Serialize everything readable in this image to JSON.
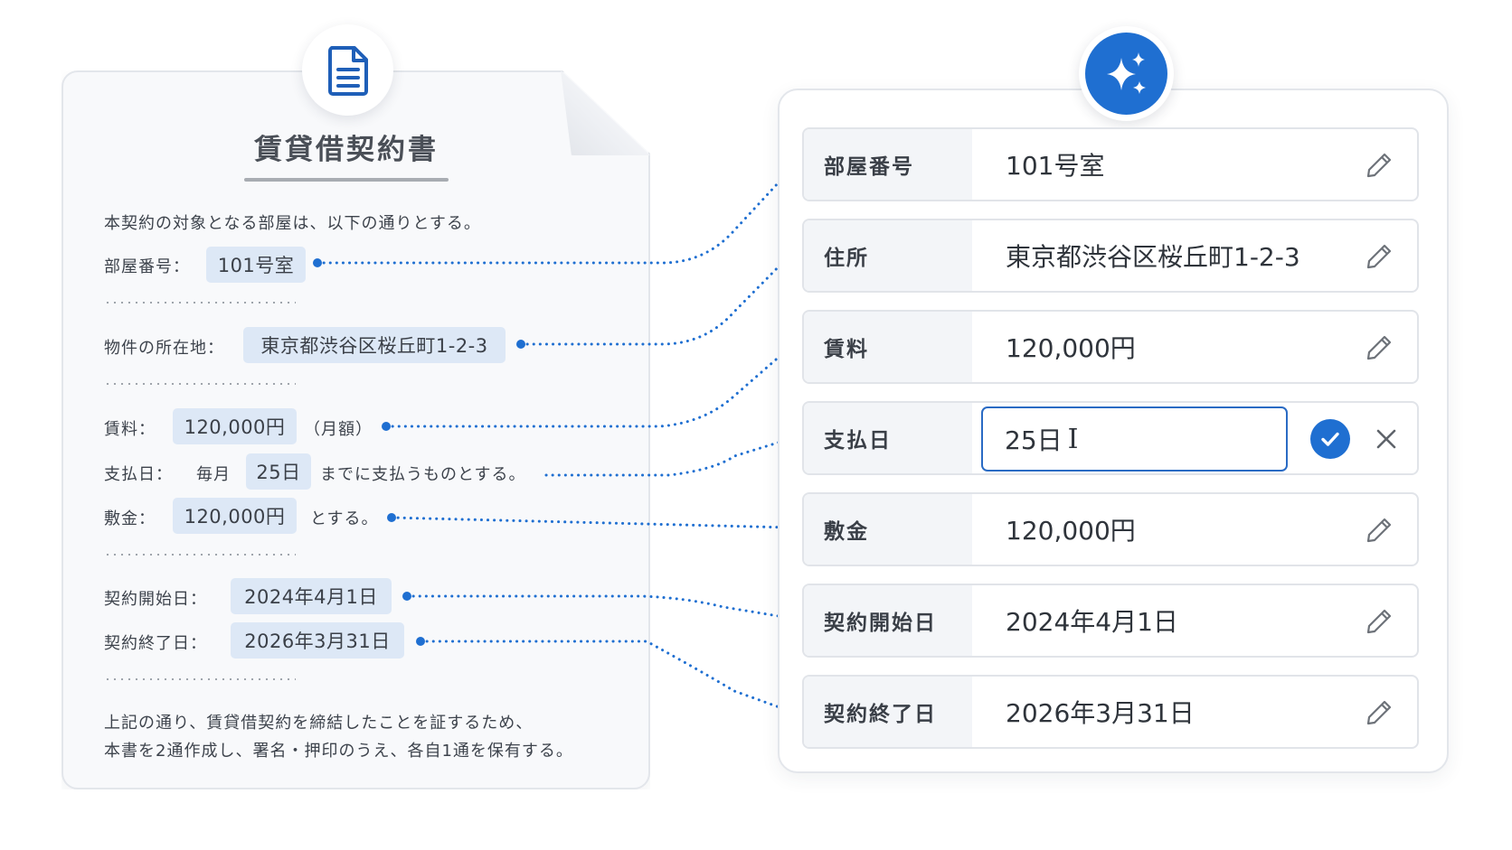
{
  "document": {
    "title": "賃貸借契約書",
    "intro": "本契約の対象となる部屋は、以下の通りとする。",
    "room_label": "部屋番号：",
    "room_value": "101号室",
    "address_label": "物件の所在地：",
    "address_value": "東京都渋谷区桜丘町1-2-3",
    "rent_label": "賃料：",
    "rent_value": "120,000円",
    "rent_suffix": "（月額）",
    "payday_label": "支払日：",
    "payday_prefix": "毎月",
    "payday_value": "25日",
    "payday_suffix": "までに支払うものとする。",
    "deposit_label": "敷金：",
    "deposit_value": "120,000円",
    "deposit_suffix": "とする。",
    "start_label": "契約開始日：",
    "start_value": "2024年4月1日",
    "end_label": "契約終了日：",
    "end_value": "2026年3月31日",
    "closing_1": "上記の通り、賃貸借契約を締結したことを証するため、",
    "closing_2": "本書を2通作成し、署名・押印のうえ、各自1通を保有する。"
  },
  "form": {
    "fields": [
      {
        "label": "部屋番号",
        "value": "101号室"
      },
      {
        "label": "住所",
        "value": "東京都渋谷区桜丘町1-2-3"
      },
      {
        "label": "賃料",
        "value": "120,000円"
      },
      {
        "label": "支払日",
        "value": "25日",
        "editing": true
      },
      {
        "label": "敷金",
        "value": "120,000円"
      },
      {
        "label": "契約開始日",
        "value": "2024年4月1日"
      },
      {
        "label": "契約終了日",
        "value": "2026年3月31日"
      }
    ]
  },
  "icons": {
    "document": "document-icon",
    "ai": "sparkle-icon",
    "edit": "pencil-icon",
    "confirm": "check-icon",
    "cancel": "close-icon"
  },
  "colors": {
    "accent": "#1f6fd1",
    "chip": "#dde8f6",
    "connector": "#1f6fd1"
  }
}
